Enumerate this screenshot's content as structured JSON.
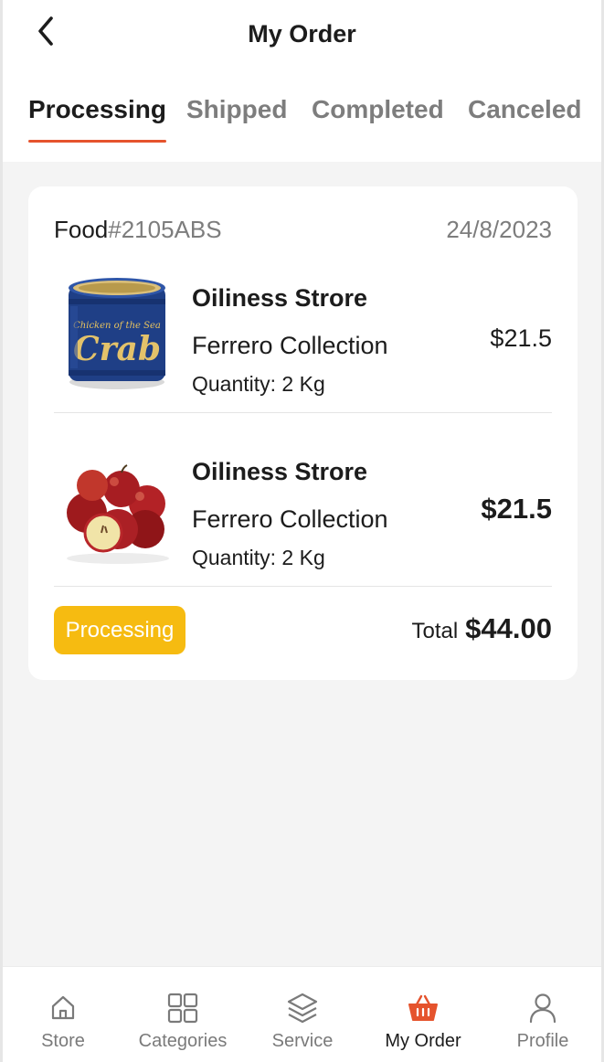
{
  "header": {
    "title": "My Order",
    "tabs": [
      {
        "label": "Processing",
        "active": true
      },
      {
        "label": "Shipped",
        "active": false
      },
      {
        "label": "Completed",
        "active": false
      },
      {
        "label": "Canceled",
        "active": false
      }
    ]
  },
  "order": {
    "category": "Food",
    "code": "#2105ABS",
    "date": "24/8/2023",
    "items": [
      {
        "image": "crab-can-image",
        "store": "Oiliness Strore",
        "product": "Ferrero Collection",
        "quantity": "Quantity: 2 Kg",
        "price": "$21.5"
      },
      {
        "image": "red-apples-image",
        "store": "Oiliness Strore",
        "product": "Ferrero Collection",
        "quantity": "Quantity: 2 Kg",
        "price": "$21.5"
      }
    ],
    "status": "Processing",
    "total_label": "Total",
    "total_value": "$44.00"
  },
  "nav": {
    "items": [
      {
        "label": "Store",
        "icon": "home-icon",
        "active": false
      },
      {
        "label": "Categories",
        "icon": "grid-icon",
        "active": false
      },
      {
        "label": "Service",
        "icon": "layers-icon",
        "active": false
      },
      {
        "label": "My Order",
        "icon": "basket-icon",
        "active": true
      },
      {
        "label": "Profile",
        "icon": "user-icon",
        "active": false
      }
    ]
  },
  "colors": {
    "accent": "#e5532d",
    "status": "#f6bb11",
    "muted": "#7d7d7d",
    "background": "#f4f4f4"
  }
}
